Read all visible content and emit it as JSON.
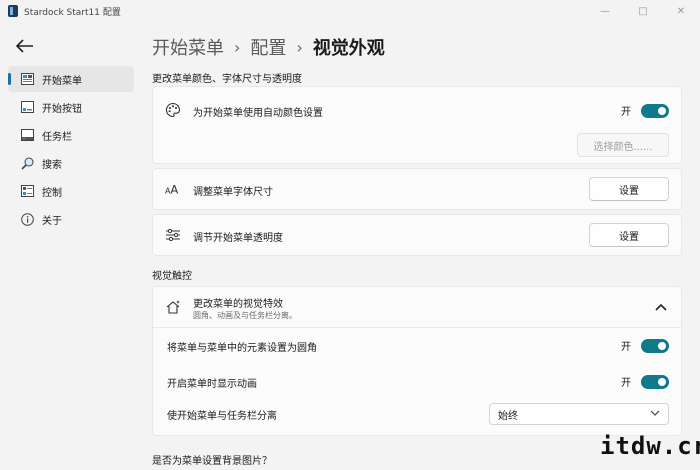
{
  "window": {
    "title": "Stardock Start11 配置"
  },
  "breadcrumb": {
    "part1": "开始菜单",
    "part2": "配置",
    "part3": "视觉外观"
  },
  "sidebar": {
    "items": [
      {
        "label": "开始菜单",
        "icon": "start-menu-icon"
      },
      {
        "label": "开始按钮",
        "icon": "start-button-icon"
      },
      {
        "label": "任务栏",
        "icon": "taskbar-icon"
      },
      {
        "label": "搜索",
        "icon": "search-icon"
      },
      {
        "label": "控制",
        "icon": "control-icon"
      },
      {
        "label": "关于",
        "icon": "info-icon"
      }
    ]
  },
  "section1": {
    "title": "更改菜单颜色、字体尺寸与透明度",
    "auto_color": {
      "label": "为开始菜单使用自动颜色设置",
      "state": "开"
    },
    "choose_color_button": "选择颜色......",
    "font_size": {
      "label": "调整菜单字体尺寸",
      "button": "设置"
    },
    "transparency": {
      "label": "调节开始菜单透明度",
      "button": "设置"
    }
  },
  "section2": {
    "title": "视觉触控",
    "effects": {
      "label": "更改菜单的视觉特效",
      "sublabel": "圆角、动画及与任务栏分离。",
      "rounded": {
        "label": "将菜单与菜单中的元素设置为圆角",
        "state": "开"
      },
      "animation": {
        "label": "开启菜单时显示动画",
        "state": "开"
      },
      "separate": {
        "label": "使开始菜单与任务栏分离",
        "value": "始终"
      }
    }
  },
  "section3": {
    "title": "是否为菜单设置背景图片？"
  },
  "watermark": "itdw.cr",
  "colors": {
    "accent": "#0f7b8a",
    "nav_indicator": "#1d6fa5",
    "background": "#f3f3f3",
    "card": "#fbfbfb"
  }
}
